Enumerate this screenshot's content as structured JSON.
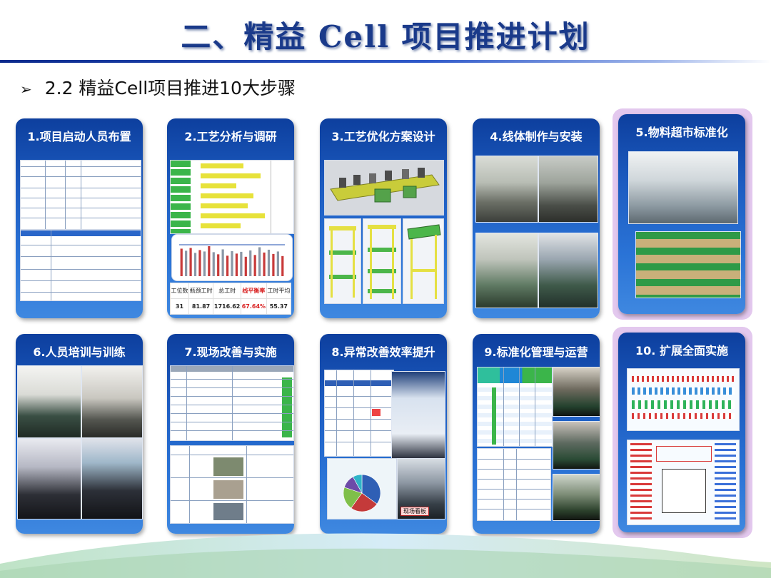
{
  "header": {
    "title": "二、精益 Cell 项目推进计划",
    "subtitle_marker": "➢",
    "subtitle": "2.2  精益Cell项目推进10大步骤"
  },
  "steps": [
    {
      "label": "1.项目启动人员布置"
    },
    {
      "label": "2.工艺分析与调研"
    },
    {
      "label": "3.工艺优化方案设计"
    },
    {
      "label": "4.线体制作与安装"
    },
    {
      "label": "5.物料超市标准化"
    },
    {
      "label": "6.人员培训与训练"
    },
    {
      "label": "7.现场改善与实施"
    },
    {
      "label": "8.异常改善效率提升"
    },
    {
      "label": "9.标准化管理与运营"
    },
    {
      "label": "10. 扩展全面实施"
    }
  ],
  "process_kpi": {
    "headers": [
      "工位数",
      "瓶颈工时",
      "总工时",
      "线平衡率",
      "工时平均"
    ],
    "values": [
      "31",
      "81.87",
      "1716.62",
      "67.64%",
      "55.37"
    ]
  },
  "bar_chart": {
    "values": [
      78,
      72,
      80,
      66,
      74,
      70,
      85,
      68,
      62,
      76,
      58,
      71,
      64,
      69,
      55,
      73,
      60,
      82,
      67,
      75,
      63,
      70,
      57
    ]
  },
  "pie_chart": {
    "values": [
      35,
      25,
      20,
      12,
      8
    ],
    "colors": [
      "#2f5fb5",
      "#c43a3a",
      "#7fbf4a",
      "#6d4ba8",
      "#2fb3c8"
    ]
  },
  "board_sign": "现场看板",
  "colors": {
    "title": "#1a3a8a",
    "card_top": "#0d3f9e",
    "card_bottom": "#3f88e0",
    "highlight": "#e3c8ee"
  }
}
